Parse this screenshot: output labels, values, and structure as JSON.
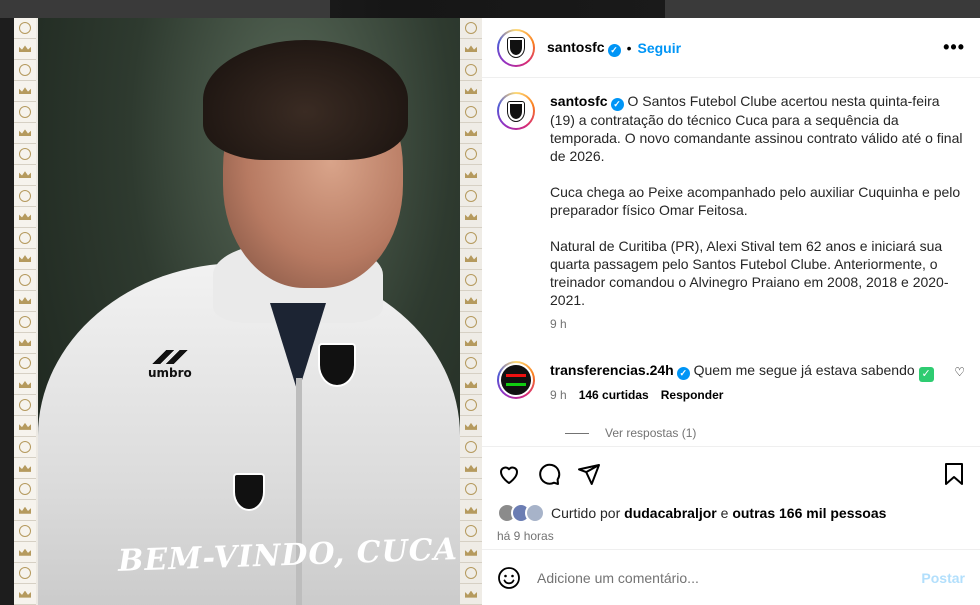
{
  "post": {
    "overlay_text": "BEM-VINDO, CUCA",
    "brand": "umbro"
  },
  "header": {
    "username": "santosfc",
    "dot": "•",
    "follow": "Seguir",
    "more": "•••"
  },
  "caption": {
    "username": "santosfc",
    "paragraphs": [
      "O Santos Futebol Clube acertou nesta quinta-feira (19) a contratação do técnico Cuca para a sequência da temporada. O novo comandante assinou contrato válido até o final de 2026.",
      "Cuca chega ao Peixe acompanhado pelo auxiliar Cuquinha e pelo preparador físico Omar Feitosa.",
      "Natural de Curitiba (PR), Alexi Stival tem 62 anos e iniciará sua quarta passagem pelo Santos Futebol Clube. Anteriormente, o treinador comandou o Alvinegro Praiano em 2008, 2018 e 2020-2021."
    ],
    "time": "9 h"
  },
  "comment": {
    "username": "transferencias.24h",
    "text": "Quem me segue já estava sabendo",
    "time": "9 h",
    "likes": "146 curtidas",
    "reply": "Responder",
    "view_replies": "Ver respostas (1)"
  },
  "likes": {
    "prefix": "Curtido por",
    "user": "dudacabraljor",
    "conj": "e",
    "others": "outras 166 mil pessoas"
  },
  "posted_ago": "há 9 horas",
  "add_comment": {
    "placeholder": "Adicione um comentário...",
    "post": "Postar"
  },
  "colors": {
    "accent": "#0095f6",
    "post_disabled": "#b2dffc"
  }
}
